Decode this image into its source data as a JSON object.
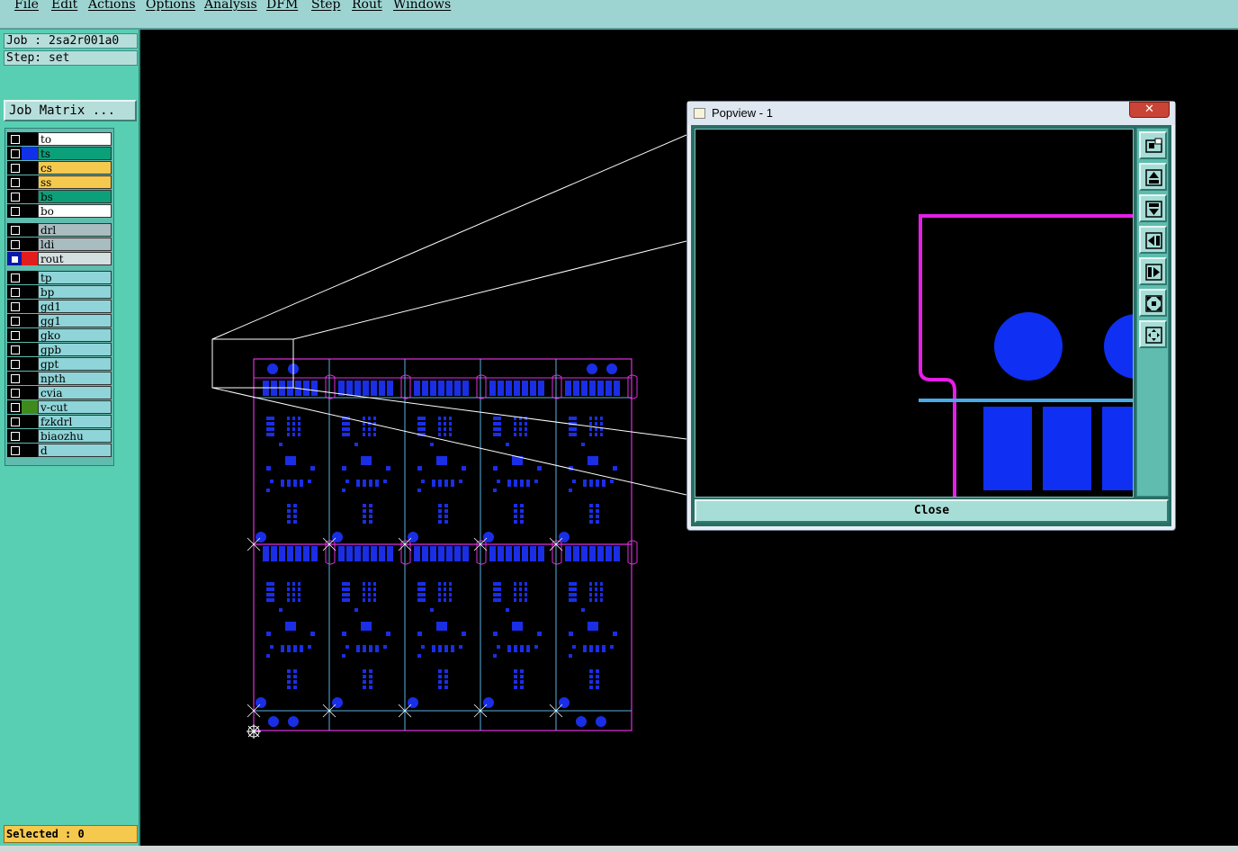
{
  "menu": [
    "File",
    "Edit",
    "Actions",
    "Options",
    "Analysis",
    "DFM",
    "Step",
    "Rout",
    "Windows"
  ],
  "job": {
    "label": "Job : 2sa2r001a0",
    "step": "Step: set"
  },
  "job_matrix_button": "Job Matrix ...",
  "layers": [
    {
      "name": "to",
      "bg": "#ffffff",
      "swatch": "#000000"
    },
    {
      "name": "ts",
      "bg": "#0ca07a",
      "swatch": "#1230e8"
    },
    {
      "name": "cs",
      "bg": "#f5c84e",
      "swatch": "#000000"
    },
    {
      "name": "ss",
      "bg": "#f5c84e",
      "swatch": "#000000"
    },
    {
      "name": "bs",
      "bg": "#0ca07a",
      "swatch": "#000000"
    },
    {
      "name": "bo",
      "bg": "#ffffff",
      "swatch": "#000000"
    },
    {
      "name": "drl",
      "bg": "#a9bcc0",
      "swatch": "#000000"
    },
    {
      "name": "ldi",
      "bg": "#a9bcc0",
      "swatch": "#000000"
    },
    {
      "name": "rout",
      "bg": "#d4dfe0",
      "swatch": "#e31d1d",
      "active": true
    },
    {
      "name": "tp",
      "bg": "#8fd4d8",
      "swatch": "#000000"
    },
    {
      "name": "bp",
      "bg": "#8fd4d8",
      "swatch": "#000000"
    },
    {
      "name": "gd1",
      "bg": "#8fd4d8",
      "swatch": "#000000"
    },
    {
      "name": "gg1",
      "bg": "#8fd4d8",
      "swatch": "#000000"
    },
    {
      "name": "gko",
      "bg": "#8fd4d8",
      "swatch": "#000000"
    },
    {
      "name": "gpb",
      "bg": "#8fd4d8",
      "swatch": "#000000"
    },
    {
      "name": "gpt",
      "bg": "#8fd4d8",
      "swatch": "#000000"
    },
    {
      "name": "npth",
      "bg": "#8fd4d8",
      "swatch": "#000000"
    },
    {
      "name": "cvia",
      "bg": "#8fd4d8",
      "swatch": "#000000"
    },
    {
      "name": "v-cut",
      "bg": "#8fd4d8",
      "swatch": "#3f8a1c"
    },
    {
      "name": "fzkdrl",
      "bg": "#8fd4d8",
      "swatch": "#000000"
    },
    {
      "name": "biaozhu",
      "bg": "#8fd4d8",
      "swatch": "#000000"
    },
    {
      "name": "d",
      "bg": "#8fd4d8",
      "swatch": "#000000"
    }
  ],
  "selected": "Selected : 0",
  "popview": {
    "title": "Popview - 1",
    "close_label": "Close",
    "close_x": "✕",
    "tools": [
      "zoom-fit-icon",
      "pan-up-icon",
      "pan-down-icon",
      "pan-left-icon",
      "pan-right-icon",
      "zoom-in-icon",
      "zoom-out-icon"
    ]
  },
  "colors": {
    "panel": "#58cfb2",
    "menubar": "#9dd4d2",
    "copper": "#1a2ee6",
    "profile": "#e030e0",
    "vcut": "#5ab0e0"
  }
}
